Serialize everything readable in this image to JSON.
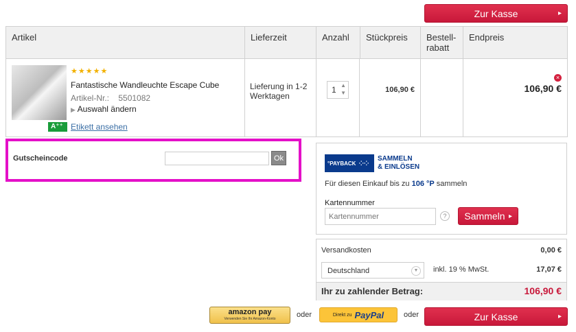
{
  "checkout": {
    "label": "Zur Kasse",
    "bottom_label": "Zur Kasse"
  },
  "table": {
    "headers": {
      "artikel": "Artikel",
      "lieferzeit": "Lieferzeit",
      "anzahl": "Anzahl",
      "stueckpreis": "Stückpreis",
      "rabatt_1": "Bestell-",
      "rabatt_2": "rabatt",
      "endpreis": "Endpreis"
    },
    "item": {
      "stars": "★★★★★",
      "name": "Fantastische Wandleuchte Escape Cube",
      "artnr_label": "Artikel-Nr.:",
      "artnr": "5501082",
      "change": "Auswahl ändern",
      "energy": "A⁺⁺",
      "label_link": "Etikett ansehen",
      "delivery": "Lieferung in 1-2 Werktagen",
      "qty": "1",
      "unit_price": "106,90 €",
      "total": "106,90 €"
    }
  },
  "voucher": {
    "label": "Gutscheincode",
    "value": "",
    "ok": "Ok"
  },
  "payback": {
    "logo": "°PAYBACK",
    "slogan_1": "SAMMELN",
    "slogan_2": "& EINLÖSEN",
    "text_pre": "Für diesen Einkauf bis zu",
    "points": "106 °P",
    "text_post": "sammeln",
    "card_label": "Kartennummer",
    "card_placeholder": "Kartennummer",
    "help": "?",
    "collect": "Sammeln"
  },
  "summary": {
    "shipping_label": "Versandkosten",
    "shipping_value": "0,00 €",
    "country": "Deutschland",
    "vat_label": "inkl. 19 % MwSt.",
    "vat_value": "17,07 €",
    "total_label": "Ihr zu zahlender Betrag:",
    "total_value": "106,90 €"
  },
  "payments": {
    "amazon_main": "amazon pay",
    "amazon_sub": "Verwenden Sie Ihr Amazon-Konto",
    "or_1": "oder",
    "paypal_pre": "Direkt zu",
    "paypal_main": "PayPal",
    "or_2": "oder"
  },
  "colors": {
    "accent": "#d4213f",
    "highlight": "#e410c8",
    "payback_blue": "#0a3a8c"
  }
}
